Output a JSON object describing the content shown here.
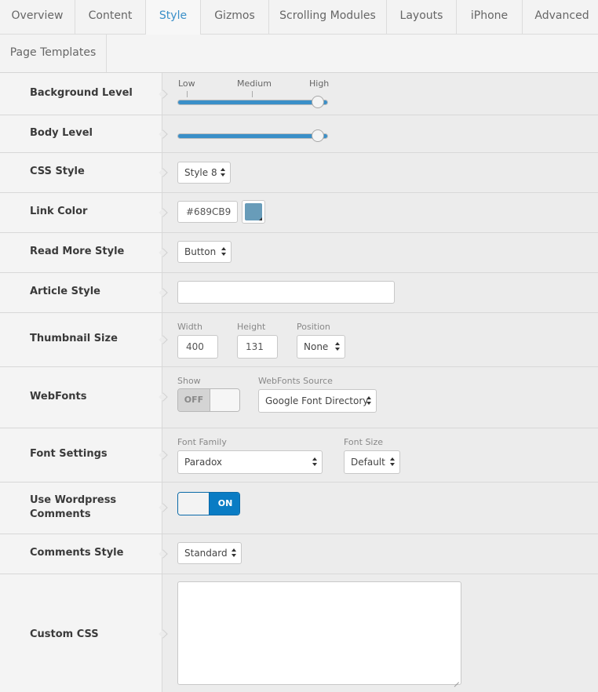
{
  "tabs": [
    "Overview",
    "Content",
    "Style",
    "Gizmos",
    "Scrolling Modules",
    "Layouts",
    "iPhone",
    "Advanced",
    "Page Templates"
  ],
  "active_tab": "Style",
  "rows": {
    "background_level": {
      "label": "Background Level",
      "ticks": [
        "Low",
        "Medium",
        "High"
      ],
      "value": "High",
      "level": 1.0
    },
    "body_level": {
      "label": "Body Level",
      "level": 1.0
    },
    "css_style": {
      "label": "CSS Style",
      "value": "Style 8"
    },
    "link_color": {
      "label": "Link Color",
      "value": "#689CB9",
      "swatch": "#689CB9"
    },
    "read_more_style": {
      "label": "Read More Style",
      "value": "Button"
    },
    "article_style": {
      "label": "Article Style",
      "value": ""
    },
    "thumbnail_size": {
      "label": "Thumbnail Size",
      "width_label": "Width",
      "width": "400",
      "height_label": "Height",
      "height": "131",
      "position_label": "Position",
      "position": "None"
    },
    "webfonts": {
      "label": "WebFonts",
      "show_label": "Show",
      "show_value": "OFF",
      "source_label": "WebFonts Source",
      "source": "Google Font Directory"
    },
    "font_settings": {
      "label": "Font Settings",
      "family_label": "Font Family",
      "family": "Paradox",
      "size_label": "Font Size",
      "size": "Default"
    },
    "wordpress_comments": {
      "label_line1": "Use Wordpress",
      "label_line2": "Comments",
      "value": "ON"
    },
    "comments_style": {
      "label": "Comments Style",
      "value": "Standard"
    },
    "custom_css": {
      "label": "Custom CSS",
      "value": ""
    }
  },
  "colors": {
    "accent": "#3A8FC8",
    "toggle_on": "#0A7CC4"
  }
}
